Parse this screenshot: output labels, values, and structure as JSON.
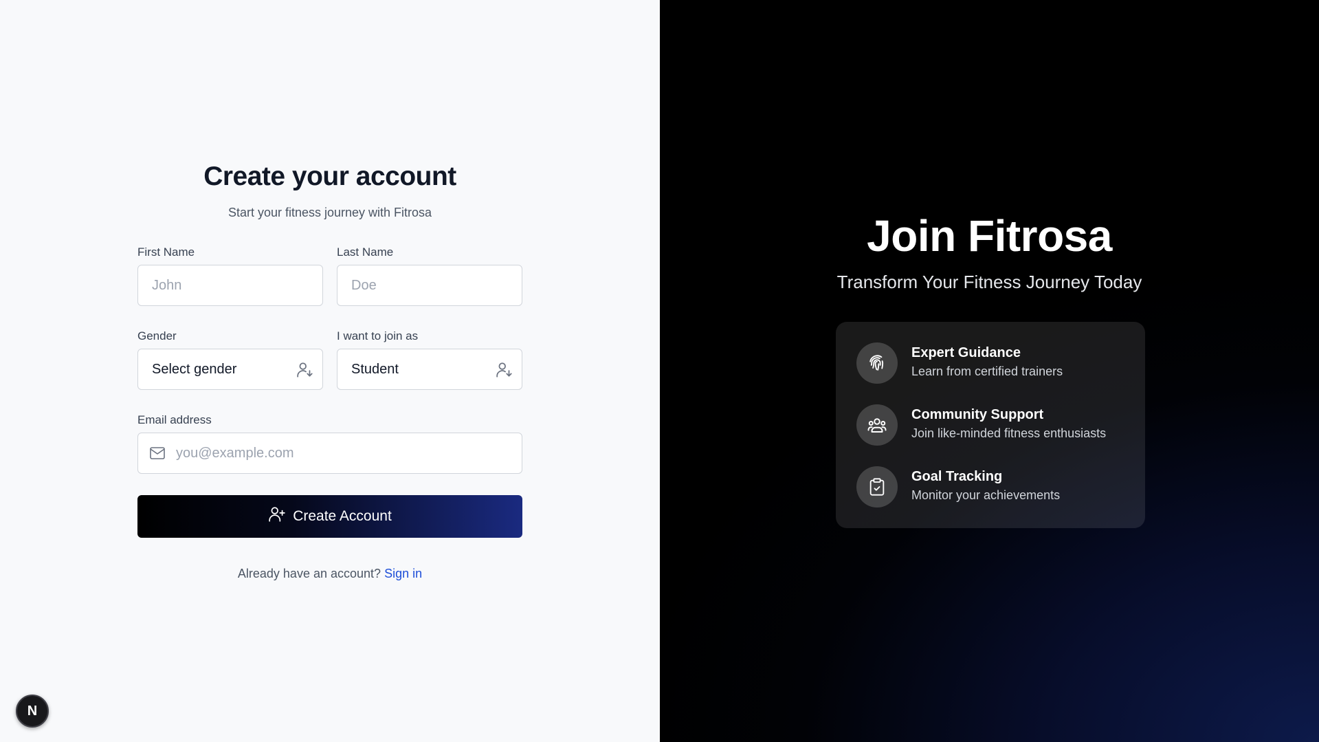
{
  "form": {
    "title": "Create your account",
    "subtitle": "Start your fitness journey with Fitrosa",
    "first_name": {
      "label": "First Name",
      "placeholder": "John",
      "value": ""
    },
    "last_name": {
      "label": "Last Name",
      "placeholder": "Doe",
      "value": ""
    },
    "gender": {
      "label": "Gender",
      "selected": "Select gender"
    },
    "role": {
      "label": "I want to join as",
      "selected": "Student"
    },
    "email": {
      "label": "Email address",
      "placeholder": "you@example.com",
      "value": ""
    },
    "submit_label": "Create Account",
    "signin_prompt": "Already have an account?",
    "signin_link": "Sign in"
  },
  "badge": {
    "letter": "N"
  },
  "promo": {
    "title": "Join Fitrosa",
    "subtitle": "Transform Your Fitness Journey Today",
    "features": [
      {
        "title": "Expert Guidance",
        "desc": "Learn from certified trainers",
        "icon": "fingerprint-icon"
      },
      {
        "title": "Community Support",
        "desc": "Join like-minded fitness enthusiasts",
        "icon": "users-group-icon"
      },
      {
        "title": "Goal Tracking",
        "desc": "Monitor your achievements",
        "icon": "clipboard-check-icon"
      }
    ]
  },
  "colors": {
    "accent_link": "#1d4ed8",
    "button_gradient_start": "#000000",
    "button_gradient_end": "#1a2a80",
    "right_bg": "#000000"
  }
}
